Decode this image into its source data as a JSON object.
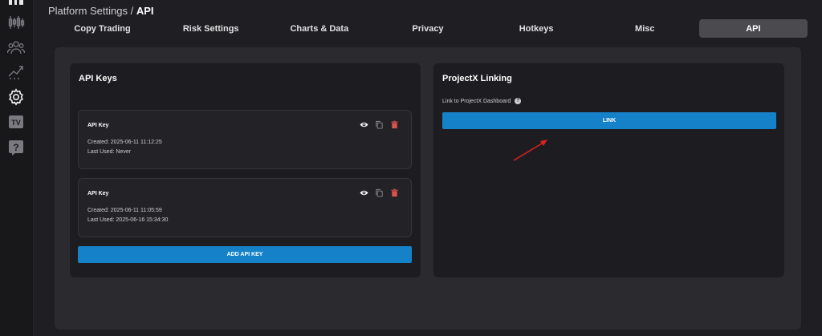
{
  "breadcrumb": {
    "parent": "Platform Settings",
    "separator": " / ",
    "current": "API"
  },
  "tabs": [
    {
      "label": "Copy Trading",
      "active": false
    },
    {
      "label": "Risk Settings",
      "active": false
    },
    {
      "label": "Charts & Data",
      "active": false
    },
    {
      "label": "Privacy",
      "active": false
    },
    {
      "label": "Hotkeys",
      "active": false
    },
    {
      "label": "Misc",
      "active": false
    },
    {
      "label": "API",
      "active": true
    }
  ],
  "sidebar": {
    "icons": [
      "dashboard-icon",
      "candlestick-chart-icon",
      "users-icon",
      "trend-chart-icon",
      "gear-icon",
      "tv-icon",
      "help-icon"
    ]
  },
  "api_keys": {
    "title": "API Keys",
    "keys": [
      {
        "name": "API Key",
        "created": "Created: 2025-06-11 11:12:25",
        "last_used": "Last Used: Never"
      },
      {
        "name": "API Key",
        "created": "Created: 2025-06-11 11:05:59",
        "last_used": "Last Used: 2025-06-16 15:34:30"
      }
    ],
    "add_button": "ADD API KEY"
  },
  "projectx": {
    "title": "ProjectX Linking",
    "link_label": "Link to ProjectX Dashboard",
    "link_button": "LINK"
  },
  "colors": {
    "accent": "#1581c9",
    "delete": "#d9534f",
    "annotation_arrow": "#e0201c"
  }
}
